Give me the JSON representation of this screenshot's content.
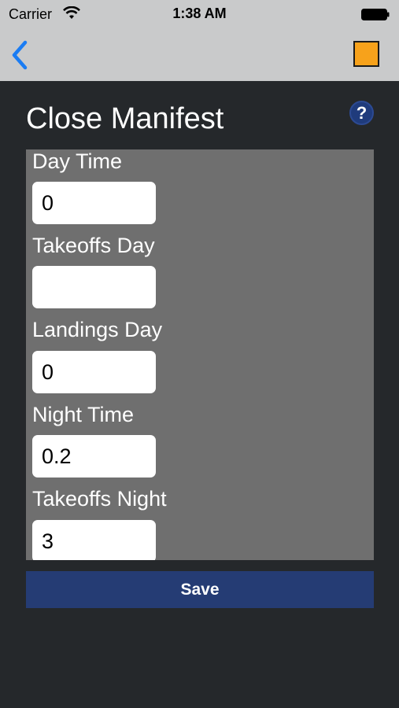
{
  "status_bar": {
    "carrier": "Carrier",
    "time": "1:38 AM"
  },
  "nav": {
    "back_icon": "chevron-left-icon",
    "accent_color": "#f7a21b",
    "back_color": "#1a7cf3"
  },
  "page": {
    "title": "Close Manifest",
    "help_label": "?"
  },
  "form": {
    "fields": [
      {
        "label": "Day Time",
        "value": "0"
      },
      {
        "label": "Takeoffs Day",
        "value": ""
      },
      {
        "label": "Landings Day",
        "value": "0"
      },
      {
        "label": "Night Time",
        "value": "0.2"
      },
      {
        "label": "Takeoffs Night",
        "value": "3"
      }
    ]
  },
  "actions": {
    "save_label": "Save"
  }
}
